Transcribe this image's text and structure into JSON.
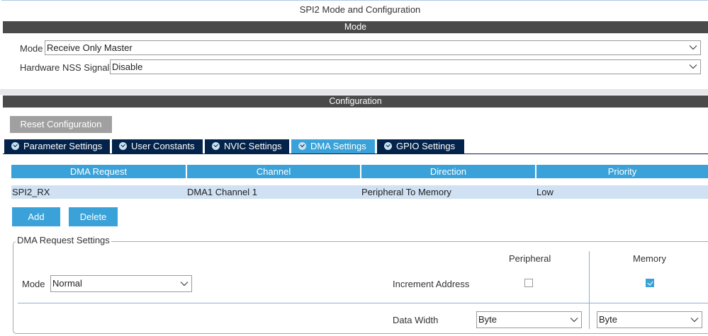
{
  "window": {
    "title": "SPI2 Mode and Configuration"
  },
  "mode_section": {
    "header": "Mode",
    "mode_label": "Mode",
    "mode_value": "Receive Only Master",
    "nss_label": "Hardware NSS Signal",
    "nss_value": "Disable"
  },
  "config_section": {
    "header": "Configuration",
    "reset_button": "Reset Configuration",
    "tabs": [
      {
        "label": "Parameter Settings",
        "active": false
      },
      {
        "label": "User Constants",
        "active": false
      },
      {
        "label": "NVIC Settings",
        "active": false
      },
      {
        "label": "DMA Settings",
        "active": true
      },
      {
        "label": "GPIO Settings",
        "active": false
      }
    ]
  },
  "dma_table": {
    "columns": [
      "DMA Request",
      "Channel",
      "Direction",
      "Priority"
    ],
    "rows": [
      [
        "SPI2_RX",
        "DMA1 Channel 1",
        "Peripheral To Memory",
        "Low"
      ]
    ]
  },
  "actions": {
    "add": "Add",
    "delete": "Delete"
  },
  "dma_request_settings": {
    "title": "DMA Request Settings",
    "mode_label": "Mode",
    "mode_value": "Normal",
    "peripheral_header": "Peripheral",
    "memory_header": "Memory",
    "increment_label": "Increment Address",
    "peripheral_increment": false,
    "memory_increment": true,
    "data_width_label": "Data Width",
    "peripheral_width": "Byte",
    "memory_width": "Byte"
  },
  "colors": {
    "accent": "#3aa2d8",
    "tab_inactive": "#03234b",
    "section_bar": "#4a4a4a",
    "row_selected": "#cfe1f2"
  },
  "icons": {
    "tab_status": "check-circle-icon",
    "dropdown": "chevron-down-icon"
  }
}
